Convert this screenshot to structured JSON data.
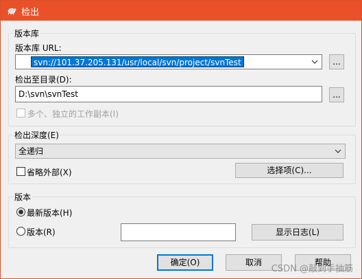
{
  "window": {
    "title": "检出",
    "title_bar_color": "#ea5128"
  },
  "repository_group": {
    "legend": "版本库",
    "url_label": "版本库 URL:",
    "url_value": "svn://101.37.205.131/usr/local/svn/project/svnTest",
    "url_browse_label": "...",
    "checkout_dir_label": "检出至目录(D):",
    "checkout_dir_value": "D:\\svn\\svnTest",
    "dir_browse_label": "...",
    "multiple_checkbox_label": "多个、独立的工作副本(I)",
    "multiple_checkbox_checked": false,
    "multiple_checkbox_enabled": false
  },
  "depth_group": {
    "legend": "检出深度(E)",
    "depth_selected": "全递归",
    "omit_externals_label": "省略外部(X)",
    "omit_externals_checked": false,
    "choose_items_label": "选择项(C)..."
  },
  "revision_group": {
    "legend": "版本",
    "head_radio_label": "最新版本(H)",
    "head_radio_selected": true,
    "revision_radio_label": "版本(R)",
    "revision_radio_selected": false,
    "revision_value": "",
    "show_log_label": "显示日志(L)"
  },
  "footer": {
    "ok_label": "确定(O)",
    "cancel_label": "取消",
    "help_label": "帮助"
  },
  "watermark": "CSDN @敲到手抽筋"
}
